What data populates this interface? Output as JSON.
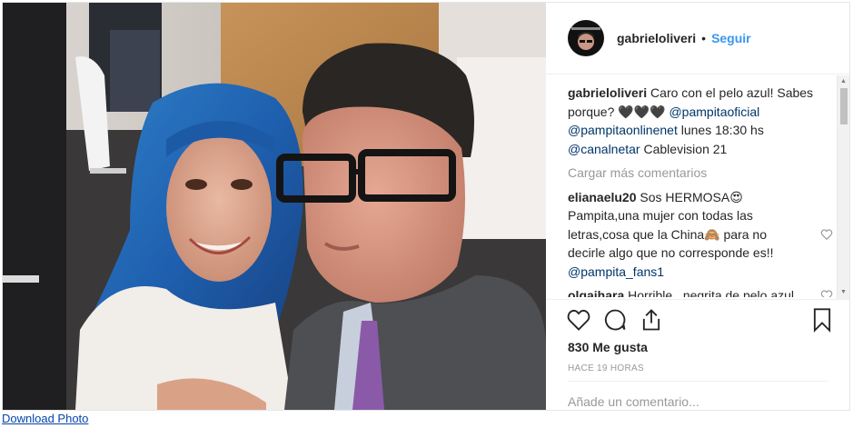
{
  "post": {
    "username": "gabrieloliveri",
    "separator": "•",
    "follow_label": "Seguir",
    "caption": {
      "username": "gabrieloliveri",
      "text_1": "Caro con el pelo azul! Sabes porque? 🖤🖤🖤",
      "mention_1": "@pampitaoficial",
      "mention_2": "@pampitaonlinenet",
      "text_2": "lunes 18:30 hs",
      "mention_3": "@canalnetar",
      "text_3": "Cablevision 21"
    },
    "load_more_label": "Cargar más comentarios",
    "comments": [
      {
        "username": "elianaelu20",
        "text": "Sos HERMOSA😍 Pampita,una mujer con todas las letras,cosa que la China🙈 para no decirle algo que no corresponde es!!",
        "mention": "@pampita_fans1"
      },
      {
        "username": "olgaihara",
        "text": "Horrible...negrita de pelo azul, parece pocahontas",
        "mention": ""
      }
    ],
    "likes_label": "830 Me gusta",
    "time_label": "HACE 19 HORAS",
    "comment_placeholder": "Añade un comentario..."
  },
  "footer": {
    "download_label": "Download Photo"
  },
  "icons": {
    "like": "heart-outline-icon",
    "comment": "speech-bubble-icon",
    "share": "share-upload-icon",
    "save": "bookmark-icon"
  },
  "colors": {
    "link_blue": "#3897f0",
    "mention_blue": "#003569",
    "muted": "#999999",
    "text": "#262626"
  }
}
